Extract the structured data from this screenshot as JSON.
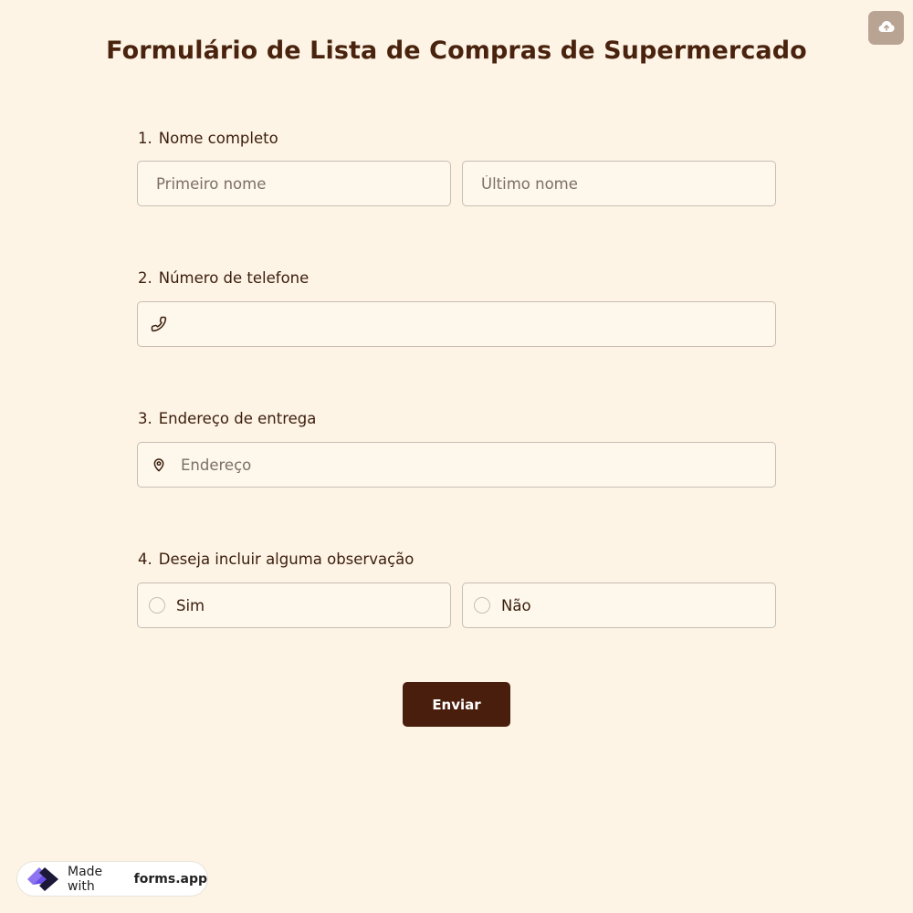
{
  "form": {
    "title": "Formulário de Lista de Compras de Supermercado",
    "questions": [
      {
        "number": "1.",
        "label": "Nome completo",
        "first_name_placeholder": "Primeiro nome",
        "last_name_placeholder": "Último nome"
      },
      {
        "number": "2.",
        "label": "Número de telefone",
        "icon": "phone-icon",
        "placeholder": ""
      },
      {
        "number": "3.",
        "label": "Endereço de entrega",
        "icon": "map-pin-icon",
        "placeholder": "Endereço"
      },
      {
        "number": "4.",
        "label": "Deseja incluir alguma observação",
        "options": [
          "Sim",
          "Não"
        ]
      }
    ],
    "submit_label": "Enviar"
  },
  "toolbar": {
    "upload_icon": "cloud-upload-icon"
  },
  "badge": {
    "prefix": "Made with",
    "brand": "forms.app"
  },
  "colors": {
    "background": "#fdf4e6",
    "field_background": "#fdf7ec",
    "field_border": "#c8beb2",
    "title": "#4a230e",
    "button": "#4a1e0c",
    "upload_button": "#b9a493"
  }
}
